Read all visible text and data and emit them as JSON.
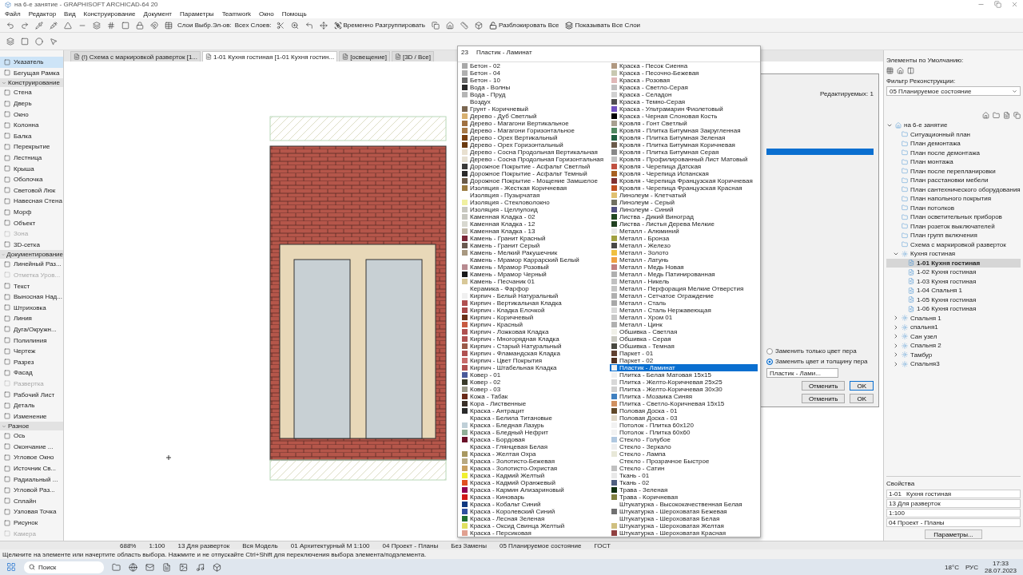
{
  "window": {
    "title": "на 6-е занятие - GRAPHISOFT ARCHICAD-64 20"
  },
  "menu": [
    "Файл",
    "Редактор",
    "Вид",
    "Конструирование",
    "Документ",
    "Параметры",
    "Teamwork",
    "Окно",
    "Помощь"
  ],
  "toolbar": {
    "layers_label": "Слои Выбр.Эл-ов:",
    "all_layers_label": "Всех Слоев:",
    "ungroup": "Временно Разгруппировать",
    "unlock_all": "Разблокировать Все",
    "show_layers": "Показывать Все Слои"
  },
  "tabs": [
    {
      "label": "(!) Схема с маркировкой разверток [1...",
      "selected": false
    },
    {
      "label": "1-01 Кухня гостиная [1-01 Кухня гостин...",
      "selected": true
    },
    {
      "label": "[освещение]",
      "selected": false
    },
    {
      "label": "[3D / Все]",
      "selected": false
    }
  ],
  "toolbox": {
    "top_items": [
      {
        "label": "Указатель",
        "selected": true,
        "disabled": false
      },
      {
        "label": "Бегущая Рамка",
        "selected": false,
        "disabled": false
      }
    ],
    "sections": [
      {
        "title": "Конструирование",
        "expanded": true,
        "items": [
          {
            "label": "Стена",
            "selected": false,
            "disabled": false
          },
          {
            "label": "Дверь",
            "selected": false,
            "disabled": false
          },
          {
            "label": "Окно",
            "selected": false,
            "disabled": false
          },
          {
            "label": "Колонна",
            "selected": false,
            "disabled": false
          },
          {
            "label": "Балка",
            "selected": false,
            "disabled": false
          },
          {
            "label": "Перекрытие",
            "selected": false,
            "disabled": false
          },
          {
            "label": "Лестница",
            "selected": false,
            "disabled": false
          },
          {
            "label": "Крыша",
            "selected": false,
            "disabled": false
          },
          {
            "label": "Оболочка",
            "selected": false,
            "disabled": false
          },
          {
            "label": "Световой Люк",
            "selected": false,
            "disabled": false
          },
          {
            "label": "Навесная Стена",
            "selected": false,
            "disabled": false
          },
          {
            "label": "Морф",
            "selected": false,
            "disabled": false
          },
          {
            "label": "Объект",
            "selected": false,
            "disabled": false
          },
          {
            "label": "Зона",
            "selected": false,
            "disabled": true
          },
          {
            "label": "3D-сетка",
            "selected": false,
            "disabled": false
          }
        ]
      },
      {
        "title": "Документирование",
        "expanded": true,
        "items": [
          {
            "label": "Линейный Раз...",
            "selected": false,
            "disabled": false
          },
          {
            "label": "Отметка Уров...",
            "selected": false,
            "disabled": true
          },
          {
            "label": "Текст",
            "selected": false,
            "disabled": false
          },
          {
            "label": "Выносная Над...",
            "selected": false,
            "disabled": false
          },
          {
            "label": "Штриховка",
            "selected": false,
            "disabled": false
          },
          {
            "label": "Линия",
            "selected": false,
            "disabled": false
          },
          {
            "label": "Дуга/Окружн...",
            "selected": false,
            "disabled": false
          },
          {
            "label": "Полилиния",
            "selected": false,
            "disabled": false
          },
          {
            "label": "Чертеж",
            "selected": false,
            "disabled": false
          },
          {
            "label": "Разрез",
            "selected": false,
            "disabled": false
          },
          {
            "label": "Фасад",
            "selected": false,
            "disabled": false
          },
          {
            "label": "Развертка",
            "selected": false,
            "disabled": true
          },
          {
            "label": "Рабочий Лист",
            "selected": false,
            "disabled": false
          },
          {
            "label": "Деталь",
            "selected": false,
            "disabled": false
          },
          {
            "label": "Изменение",
            "selected": false,
            "disabled": false
          }
        ]
      },
      {
        "title": "Разное",
        "expanded": true,
        "items": [
          {
            "label": "Ось",
            "selected": false,
            "disabled": false
          },
          {
            "label": "Окончание ...",
            "selected": false,
            "disabled": false
          },
          {
            "label": "Угловое Окно",
            "selected": false,
            "disabled": false
          },
          {
            "label": "Источник Св...",
            "selected": false,
            "disabled": false
          },
          {
            "label": "Радиальный ...",
            "selected": false,
            "disabled": false
          },
          {
            "label": "Угловой Раз...",
            "selected": false,
            "disabled": false
          },
          {
            "label": "Сплайн",
            "selected": false,
            "disabled": false
          },
          {
            "label": "Узловая Точка",
            "selected": false,
            "disabled": false
          },
          {
            "label": "Рисунок",
            "selected": false,
            "disabled": false
          },
          {
            "label": "Камера",
            "selected": false,
            "disabled": true
          }
        ]
      }
    ]
  },
  "material_popup": {
    "index": "23",
    "current": "Пластик - Ламинат",
    "column_1": [
      {
        "name": "Бетон - 02",
        "color": "#a8a8a8",
        "selected": false
      },
      {
        "name": "Бетон - 04",
        "color": "#b0b0b0",
        "selected": false
      },
      {
        "name": "Бетон - 10",
        "color": "#6a6a6a",
        "selected": false
      },
      {
        "name": "Вода - Волны",
        "color": "#2a2a2a",
        "selected": false
      },
      {
        "name": "Вода - Пруд",
        "color": "#b5b5b5",
        "selected": false
      },
      {
        "name": "Воздух",
        "selected": false
      },
      {
        "name": "Грунт - Коричневый",
        "color": "#7a6650",
        "selected": false
      },
      {
        "name": "Дерево - Дуб Светлый",
        "color": "#d8b070",
        "selected": false
      },
      {
        "name": "Дерево - Магагони Вертикальное",
        "color": "#a07040",
        "selected": false
      },
      {
        "name": "Дерево - Магагони Горизонтальное",
        "color": "#a87a48",
        "selected": false
      },
      {
        "name": "Дерево - Орех Вертикальный",
        "color": "#7a4010",
        "selected": false
      },
      {
        "name": "Дерево - Орех Горизонтальный",
        "color": "#6a3a10",
        "selected": false
      },
      {
        "name": "Дерево - Сосна Продольная Вертикальная",
        "color": "#e8e0d0",
        "selected": false
      },
      {
        "name": "Дерево - Сосна Продольная Горизонтальная",
        "color": "#e6e0d2",
        "selected": false
      },
      {
        "name": "Дорожное Покрытие - Асфальт Светлый",
        "color": "#3a3a3a",
        "selected": false
      },
      {
        "name": "Дорожное Покрытие - Асфальт Темный",
        "color": "#2a2a2a",
        "selected": false
      },
      {
        "name": "Дорожное Покрытие - Мощение Замшелое",
        "color": "#6a5a48",
        "selected": false
      },
      {
        "name": "Изоляция - Жесткая Коричневая",
        "color": "#9a7a40",
        "selected": false
      },
      {
        "name": "Изоляция - Пузырчатая",
        "selected": false
      },
      {
        "name": "Изоляция - Стекловолокно",
        "color": "#f0f0a0",
        "selected": false
      },
      {
        "name": "Изоляция - Целлулоид",
        "color": "#c8c8c0",
        "selected": false
      },
      {
        "name": "Каменная Кладка - 02",
        "color": "#c8c8c0",
        "selected": false
      },
      {
        "name": "Каменная Кладка - 12",
        "color": "#d8d8d0",
        "selected": false
      },
      {
        "name": "Каменная Кладка - 13",
        "color": "#c0b8a8",
        "selected": false
      },
      {
        "name": "Камень - Гранит Красный",
        "color": "#7a2838",
        "selected": false
      },
      {
        "name": "Камень - Гранит Серый",
        "color": "#6a5a50",
        "selected": false
      },
      {
        "name": "Камень - Мелкий Ракушечник",
        "color": "#a89880",
        "selected": false
      },
      {
        "name": "Камень - Мрамор Каррарский Белый",
        "selected": false
      },
      {
        "name": "Камень - Мрамор Розовый",
        "color": "#b88a90",
        "selected": false
      },
      {
        "name": "Камень - Мрамор Черный",
        "color": "#1a1a1a",
        "selected": false
      },
      {
        "name": "Камень - Песчаник 01",
        "color": "#d8c898",
        "selected": false
      },
      {
        "name": "Керамика - Фарфор",
        "selected": false
      },
      {
        "name": "Кирпич - Белый Натуральный",
        "color": "#f0f0f0",
        "selected": false
      },
      {
        "name": "Кирпич - Вертикальная Кладка",
        "color": "#b05050",
        "selected": false
      },
      {
        "name": "Кирпич - Кладка Елочкой",
        "color": "#a84848",
        "selected": false
      },
      {
        "name": "Кирпич - Коричневый",
        "color": "#6a3018",
        "selected": false
      },
      {
        "name": "Кирпич - Красный",
        "color": "#c85a40",
        "selected": false
      },
      {
        "name": "Кирпич - Ложковая Кладка",
        "color": "#b05050",
        "selected": false
      },
      {
        "name": "Кирпич - Многорядная Кладка",
        "color": "#b05050",
        "selected": false
      },
      {
        "name": "Кирпич - Старый Натуральный",
        "color": "#9a5a48",
        "selected": false
      },
      {
        "name": "Кирпич - Фламандская Кладка",
        "color": "#b05050",
        "selected": false
      },
      {
        "name": "Кирпич - Цвет Покрытия",
        "color": "#c86a6a",
        "selected": false
      },
      {
        "name": "Кирпич - Штабельная Кладка",
        "color": "#b05050",
        "selected": false
      },
      {
        "name": "Ковер - 01",
        "color": "#4a5a9a",
        "selected": false
      },
      {
        "name": "Ковер - 02",
        "color": "#3a3a2a",
        "selected": false
      },
      {
        "name": "Ковер - 03",
        "color": "#9a9888",
        "selected": false
      },
      {
        "name": "Кожа - Табак",
        "color": "#6a2a18",
        "selected": false
      },
      {
        "name": "Кора - Лиственные",
        "color": "#3a3028",
        "selected": false
      },
      {
        "name": "Краска - Антрацит",
        "color": "#2a2a2a",
        "selected": false
      },
      {
        "name": "Краска - Белила Титановые",
        "selected": false
      },
      {
        "name": "Краска - Бледная Лазурь",
        "color": "#c0d0d8",
        "selected": false
      },
      {
        "name": "Краска - Бледный Нефрит",
        "color": "#90b098",
        "selected": false
      },
      {
        "name": "Краска - Бордовая",
        "color": "#6a1028",
        "selected": false
      },
      {
        "name": "Краска - Глянцевая Белая",
        "selected": false
      },
      {
        "name": "Краска - Желтая Охра",
        "color": "#a89860",
        "selected": false
      },
      {
        "name": "Краска - Золотисто-Бежевая",
        "color": "#b8a880",
        "selected": false
      },
      {
        "name": "Краска - Золотисто-Охристая",
        "color": "#c8a060",
        "selected": false
      },
      {
        "name": "Краска - Кадмий Желтый",
        "color": "#f0f030",
        "selected": false
      },
      {
        "name": "Краска - Кадмий Оранжевый",
        "color": "#e05020",
        "selected": false
      },
      {
        "name": "Краска - Кармин Ализариновый",
        "color": "#900050",
        "selected": false
      },
      {
        "name": "Краска - Киноварь",
        "color": "#d01818",
        "selected": false
      },
      {
        "name": "Краска - Кобальт Синий",
        "color": "#103880",
        "selected": false
      },
      {
        "name": "Краска - Королевский Синий",
        "color": "#3050a0",
        "selected": false
      },
      {
        "name": "Краска - Лесная Зеленая",
        "color": "#207030",
        "selected": false
      },
      {
        "name": "Краска - Оксид Свинца Желтый",
        "color": "#e0e060",
        "selected": false
      },
      {
        "name": "Краска - Персиковая",
        "color": "#e0a090",
        "selected": false
      }
    ],
    "column_2": [
      {
        "name": "Краска - Песок Сиенна",
        "color": "#b09880",
        "selected": false
      },
      {
        "name": "Краска - Песочно-Бежевая",
        "color": "#c8c8b0",
        "selected": false
      },
      {
        "name": "Краска - Розовая",
        "color": "#e0b8b8",
        "selected": false
      },
      {
        "name": "Краска - Светло-Серая",
        "color": "#c0c0c0",
        "selected": false
      },
      {
        "name": "Краска - Селадон",
        "color": "#d0d0d0",
        "selected": false
      },
      {
        "name": "Краска - Темно-Серая",
        "color": "#505050",
        "selected": false
      },
      {
        "name": "Краска - Ультрамарин Фиолетовый",
        "color": "#7050c0",
        "selected": false
      },
      {
        "name": "Краска - Черная Слоновая Кость",
        "color": "#000000",
        "selected": false
      },
      {
        "name": "Кровля - Гонт Светлый",
        "color": "#a8a090",
        "selected": false
      },
      {
        "name": "Кровля - Плитка Битумная Закругленная",
        "color": "#508860",
        "selected": false
      },
      {
        "name": "Кровля - Плитка Битумная Зеленая",
        "color": "#206040",
        "selected": false
      },
      {
        "name": "Кровля - Плитка Битумная Коричневая",
        "color": "#6a5a4a",
        "selected": false
      },
      {
        "name": "Кровля - Плитка Битумная Серая",
        "color": "#888888",
        "selected": false
      },
      {
        "name": "Кровля - Профилированный Лист Матовый",
        "color": "#c0c0c0",
        "selected": false
      },
      {
        "name": "Кровля - Черепица Датская",
        "color": "#c05040",
        "selected": false
      },
      {
        "name": "Кровля - Черепица Испанская",
        "color": "#a86020",
        "selected": false
      },
      {
        "name": "Кровля - Черепица Французская Коричневая",
        "color": "#803030",
        "selected": false
      },
      {
        "name": "Кровля - Черепица Французская Красная",
        "color": "#c05020",
        "selected": false
      },
      {
        "name": "Линолеум - Клетчатый",
        "color": "#e0c070",
        "selected": false
      },
      {
        "name": "Линолеум - Серый",
        "color": "#707060",
        "selected": false
      },
      {
        "name": "Линолеум - Синий",
        "color": "#505080",
        "selected": false
      },
      {
        "name": "Листва - Дикий Виноград",
        "color": "#204820",
        "selected": false
      },
      {
        "name": "Листва - Листья Дерева Мелкие",
        "color": "#204020",
        "selected": false
      },
      {
        "name": "Металл - Алюминий",
        "color": "#e8e8e8",
        "selected": false
      },
      {
        "name": "Металл - Бронза",
        "color": "#a0a040",
        "selected": false
      },
      {
        "name": "Металл - Железо",
        "color": "#484848",
        "selected": false
      },
      {
        "name": "Металл - Золото",
        "color": "#f0c040",
        "selected": false
      },
      {
        "name": "Металл - Латунь",
        "color": "#f0a040",
        "selected": false
      },
      {
        "name": "Металл - Медь Новая",
        "color": "#c08080",
        "selected": false
      },
      {
        "name": "Металл - Медь Патинированная",
        "color": "#b0b0b0",
        "selected": false
      },
      {
        "name": "Металл - Никель",
        "color": "#c0c0c0",
        "selected": false
      },
      {
        "name": "Металл - Перфорация Мелкие Отверстия",
        "color": "#c4c4c4",
        "selected": false
      },
      {
        "name": "Металл - Сетчатое Ограждение",
        "color": "#b0b0b0",
        "selected": false
      },
      {
        "name": "Металл - Сталь",
        "color": "#a8a8a8",
        "selected": false
      },
      {
        "name": "Металл - Сталь Нержавеющая",
        "color": "#d8d8d8",
        "selected": false
      },
      {
        "name": "Металл - Хром 01",
        "color": "#c8c8c8",
        "selected": false
      },
      {
        "name": "Металл - Цинк",
        "color": "#b0b0b0",
        "selected": false
      },
      {
        "name": "Обшивка - Светлая",
        "color": "#f0f0e8",
        "selected": false
      },
      {
        "name": "Обшивка - Серая",
        "color": "#c8c8c0",
        "selected": false
      },
      {
        "name": "Обшивка - Темная",
        "color": "#484840",
        "selected": false
      },
      {
        "name": "Паркет - 01",
        "color": "#604030",
        "selected": false
      },
      {
        "name": "Паркет - 02",
        "color": "#503020",
        "selected": false
      },
      {
        "name": "Пластик - Ламинат",
        "color": "#f0f0f0",
        "selected": true
      },
      {
        "name": "Плитка - Белая Матовая 15х15",
        "color": "#f0f0f0",
        "selected": false
      },
      {
        "name": "Плитка - Желто-Коричневая 25х25",
        "color": "#d8d8d8",
        "selected": false
      },
      {
        "name": "Плитка - Желто-Коричневая 30х30",
        "color": "#d0d0d0",
        "selected": false
      },
      {
        "name": "Плитка - Мозаика Синяя",
        "color": "#4080c0",
        "selected": false
      },
      {
        "name": "Плитка - Светло-Коричневая 15х15",
        "color": "#d09060",
        "selected": false
      },
      {
        "name": "Половая Доска - 01",
        "color": "#604828",
        "selected": false
      },
      {
        "name": "Половая Доска - 03",
        "color": "#e0d8c8",
        "selected": false
      },
      {
        "name": "Потолок - Плитка 60х120",
        "color": "#f2f2f2",
        "selected": false
      },
      {
        "name": "Потолок - Плитка 60х60",
        "color": "#f2f2f2",
        "selected": false
      },
      {
        "name": "Стекло - Голубое",
        "color": "#b0c8e0",
        "selected": false
      },
      {
        "name": "Стекло - Зеркало",
        "color": "#eeeeee",
        "selected": false
      },
      {
        "name": "Стекло - Лампа",
        "color": "#e8e8d8",
        "selected": false
      },
      {
        "name": "Стекло - Прозрачное Быстрое",
        "selected": false
      },
      {
        "name": "Стекло - Сатин",
        "color": "#c0c0c0",
        "selected": false
      },
      {
        "name": "Ткань - 01",
        "color": "#e8e8e8",
        "selected": false
      },
      {
        "name": "Ткань - 02",
        "color": "#506080",
        "selected": false
      },
      {
        "name": "Трава - Зеленая",
        "color": "#103010",
        "selected": false
      },
      {
        "name": "Трава - Коричневая",
        "color": "#808040",
        "selected": false
      },
      {
        "name": "Штукатурка - Высококачественная Белая",
        "selected": false
      },
      {
        "name": "Штукатурка - Шероховатая Бежевая",
        "color": "#707070",
        "selected": false
      },
      {
        "name": "Штукатурка - Шероховатая Белая",
        "selected": false
      },
      {
        "name": "Штукатурка - Шероховатая Желтая",
        "color": "#d0c080",
        "selected": false
      },
      {
        "name": "Штукатурка - Шероховатая Красная",
        "color": "#904040",
        "selected": false
      }
    ]
  },
  "dialog": {
    "editable": "Редактируемых: 1",
    "options": [
      {
        "label": "Заменить только цвет пера",
        "selected": false
      },
      {
        "label": "Заменить цвет и толщину пера",
        "selected": true
      }
    ],
    "material_field": "Пластик - Лами...",
    "cancel": "Отменить",
    "ok": "OK",
    "back_cancel": "Отменить",
    "back_ok": "OK"
  },
  "right_panel": {
    "defaults_label": "Элементы по Умолчанию:",
    "filter_label": "Фильтр Реконструкции:",
    "filter_value": "05 Планируемое состояние",
    "tree": [
      {
        "label": "на 6-е занятие",
        "kind": "project",
        "expanded": true,
        "selected": false,
        "children": [
          {
            "label": "Ситуационный план",
            "kind": "folder",
            "selected": false
          },
          {
            "label": "План демонтажа",
            "kind": "folder",
            "selected": false
          },
          {
            "label": "План после демонтажа",
            "kind": "folder",
            "selected": false
          },
          {
            "label": "План монтажа",
            "kind": "folder",
            "selected": false
          },
          {
            "label": "План после перепланировки",
            "kind": "folder",
            "selected": false
          },
          {
            "label": "План расстановки мебели",
            "kind": "folder",
            "selected": false
          },
          {
            "label": "План сантехнического оборудования",
            "kind": "folder",
            "selected": false
          },
          {
            "label": "План напольного покрытия",
            "kind": "folder",
            "selected": false
          },
          {
            "label": "План потолков",
            "kind": "folder",
            "selected": false
          },
          {
            "label": "План осветительных приборов",
            "kind": "folder",
            "selected": false
          },
          {
            "label": "План розеток выключателей",
            "kind": "folder",
            "selected": false
          },
          {
            "label": "План групп включения",
            "kind": "folder",
            "selected": false
          },
          {
            "label": "Схема с маркировкой разверток",
            "kind": "folder",
            "selected": false
          },
          {
            "label": "Кухня гостиная",
            "kind": "group",
            "expanded": true,
            "selected": false,
            "children": [
              {
                "label": "1-01 Кухня гостиная",
                "kind": "view",
                "selected": true
              },
              {
                "label": "1-02 Кухня гостиная",
                "kind": "view",
                "selected": false
              },
              {
                "label": "1-03 Кухня гостиная",
                "kind": "view",
                "selected": false
              },
              {
                "label": "1-04 Спальня 1",
                "kind": "view",
                "selected": false
              },
              {
                "label": "1-05 Кухня гостиная",
                "kind": "view",
                "selected": false
              },
              {
                "label": "1-06 Кухня гостиная",
                "kind": "view",
                "selected": false
              }
            ]
          },
          {
            "label": "Спальня 1",
            "kind": "group",
            "expanded": false,
            "selected": false
          },
          {
            "label": "спальня1",
            "kind": "group",
            "expanded": false,
            "selected": false
          },
          {
            "label": "Сан узел",
            "kind": "group",
            "expanded": false,
            "selected": false
          },
          {
            "label": "Спальня 2",
            "kind": "group",
            "expanded": false,
            "selected": false
          },
          {
            "label": "Тамбур",
            "kind": "group",
            "expanded": false,
            "selected": false
          },
          {
            "label": "Спальня3",
            "kind": "group",
            "expanded": false,
            "selected": false
          }
        ]
      }
    ],
    "properties": {
      "title": "Свойства",
      "id": "1-01",
      "name": "Кухня гостиная",
      "layer": "13 Для разверток",
      "scale": "1:100",
      "set": "04 Проект - Планы",
      "button": "Параметры..."
    }
  },
  "view_bar": [
    "688%",
    "1:100",
    "13 Для разверток",
    "Вся Модель",
    "01 Архитектурный М 1:100",
    "04 Проект - Планы",
    "Без Замены",
    "05 Планируемое состояние",
    "ГОСТ"
  ],
  "status_bar": "Щелкните на элементе или начертите область выбора. Нажмите и не отпускайте Ctrl+Shift для переключения выбора элемента/подэлемента.",
  "taskbar": {
    "search": "Поиск",
    "weather": "18°C",
    "language": "РУС",
    "time": "17:33",
    "date": "28.07.2023"
  }
}
